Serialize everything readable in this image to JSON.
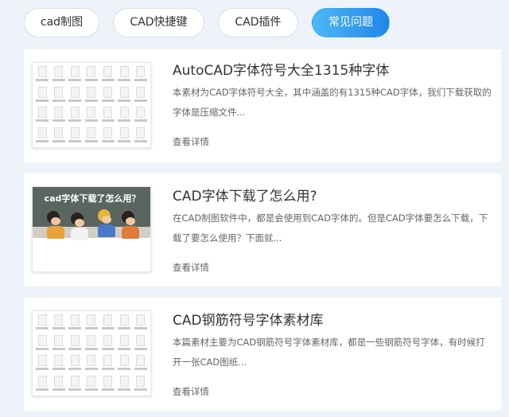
{
  "tabs": [
    {
      "label": "cad制图",
      "active": false
    },
    {
      "label": "CAD快捷键",
      "active": false
    },
    {
      "label": "CAD插件",
      "active": false
    },
    {
      "label": "常见问题",
      "active": true
    }
  ],
  "articles": [
    {
      "title": "AutoCAD字体符号大全1315种字体",
      "desc": "  本素材为CAD字体符号大全，其中涵盖的有1315种CAD字体，我们下载获取的字体是压缩文件...",
      "link": "查看详情",
      "thumb": "font-files"
    },
    {
      "title": "CAD字体下载了怎么用?",
      "desc": "在CAD制图软件中，都是会使用到CAD字体的。但是CAD字体要怎么下载，下载了要怎么使用？下面就...",
      "link": "查看详情",
      "thumb": "photo",
      "thumb_text": "cad字体下载了怎么用？"
    },
    {
      "title": "CAD钢筋符号字体素材库",
      "desc": "  本篇素材主要为CAD钢筋符号字体素材库，都是一些钢筋符号字体，有时候打开一张CAD图纸...",
      "link": "查看详情",
      "thumb": "font-files"
    }
  ],
  "colors": {
    "background": "#eef3fa",
    "active_tab_start": "#4db8f5",
    "active_tab_end": "#1f86e8"
  }
}
